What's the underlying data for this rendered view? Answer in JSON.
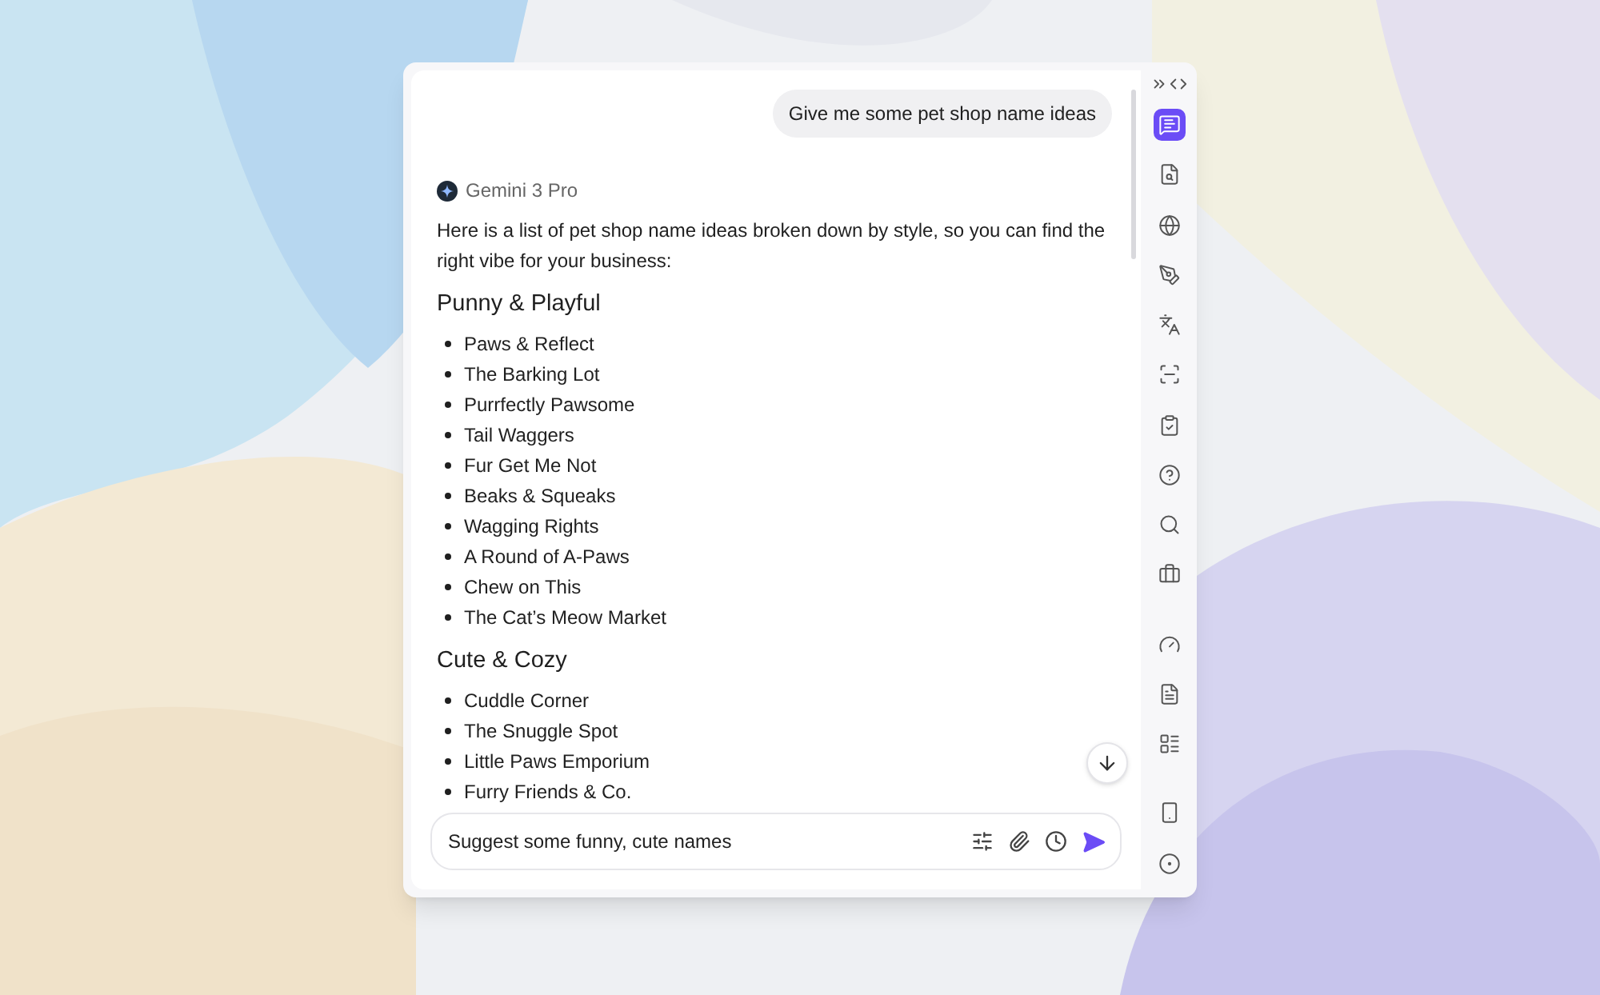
{
  "conversation": {
    "user_message": "Give me some pet shop name ideas",
    "model_name": "Gemini 3 Pro",
    "intro": "Here is a list of pet shop name ideas broken down by style, so you can find the right vibe for your business:",
    "sections": [
      {
        "heading": "Punny & Playful",
        "items": [
          "Paws & Reflect",
          "The Barking Lot",
          "Purrfectly Pawsome",
          "Tail Waggers",
          "Fur Get Me Not",
          "Beaks & Squeaks",
          "Wagging Rights",
          "A Round of A-Paws",
          "Chew on This",
          "The Cat’s Meow Market"
        ]
      },
      {
        "heading": "Cute & Cozy",
        "items": [
          "Cuddle Corner",
          "The Snuggle Spot",
          "Little Paws Emporium",
          "Furry Friends & Co."
        ]
      }
    ]
  },
  "composer": {
    "value": "Suggest some funny, cute names"
  },
  "sidebar": {
    "items": [
      {
        "kind": "chat",
        "selected": true
      },
      {
        "kind": "read",
        "selected": false
      },
      {
        "kind": "web",
        "selected": false
      },
      {
        "kind": "write",
        "selected": false
      },
      {
        "kind": "translate",
        "selected": false
      },
      {
        "kind": "scan",
        "selected": false
      },
      {
        "kind": "tasks",
        "selected": false
      },
      {
        "kind": "help",
        "selected": false
      },
      {
        "kind": "search",
        "selected": false
      },
      {
        "kind": "tools",
        "selected": false
      },
      {
        "kind": "gauge",
        "selected": false
      },
      {
        "kind": "pdf",
        "selected": false
      },
      {
        "kind": "layout",
        "selected": false
      },
      {
        "kind": "phone",
        "selected": false
      },
      {
        "kind": "settings",
        "selected": false
      }
    ]
  }
}
